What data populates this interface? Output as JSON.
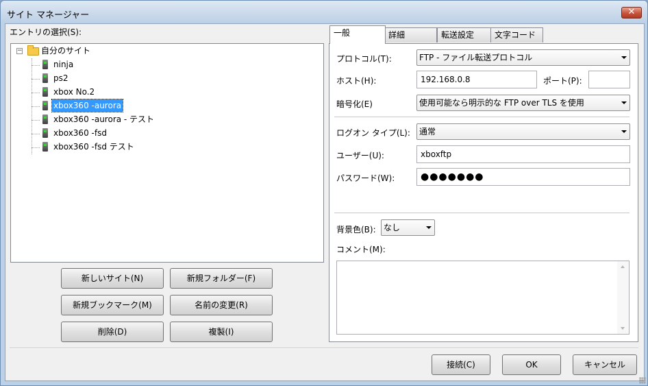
{
  "window": {
    "title": "サイト マネージャー",
    "close": "✕"
  },
  "tree": {
    "label": "エントリの選択(S):",
    "root": "自分のサイト",
    "items": [
      {
        "label": "ninja"
      },
      {
        "label": "ps2"
      },
      {
        "label": "xbox No.2"
      },
      {
        "label": "xbox360 -aurora",
        "selected": true
      },
      {
        "label": "xbox360 -aurora - テスト"
      },
      {
        "label": "xbox360 -fsd"
      },
      {
        "label": "xbox360 -fsd テスト"
      }
    ]
  },
  "left_buttons": {
    "new_site": "新しいサイト(N)",
    "new_folder": "新規フォルダー(F)",
    "new_bookmark": "新規ブックマーク(M)",
    "rename": "名前の変更(R)",
    "delete": "削除(D)",
    "duplicate": "複製(I)"
  },
  "tabs": [
    "一般",
    "詳細",
    "転送設定",
    "文字コード"
  ],
  "general": {
    "protocol_label": "プロトコル(T):",
    "protocol_value": "FTP - ファイル転送プロトコル",
    "host_label": "ホスト(H):",
    "host_value": "192.168.0.8",
    "port_label": "ポート(P):",
    "port_value": "",
    "encryption_label": "暗号化(E)",
    "encryption_value": "使用可能なら明示的な FTP over TLS を使用",
    "logon_label": "ログオン タイプ(L):",
    "logon_value": "通常",
    "user_label": "ユーザー(U):",
    "user_value": "xboxftp",
    "password_label": "パスワード(W):",
    "password_value": "●●●●●●●",
    "bgcolor_label": "背景色(B):",
    "bgcolor_value": "なし",
    "comment_label": "コメント(M):",
    "comment_value": ""
  },
  "footer": {
    "connect": "接続(C)",
    "ok": "OK",
    "cancel": "キャンセル"
  }
}
